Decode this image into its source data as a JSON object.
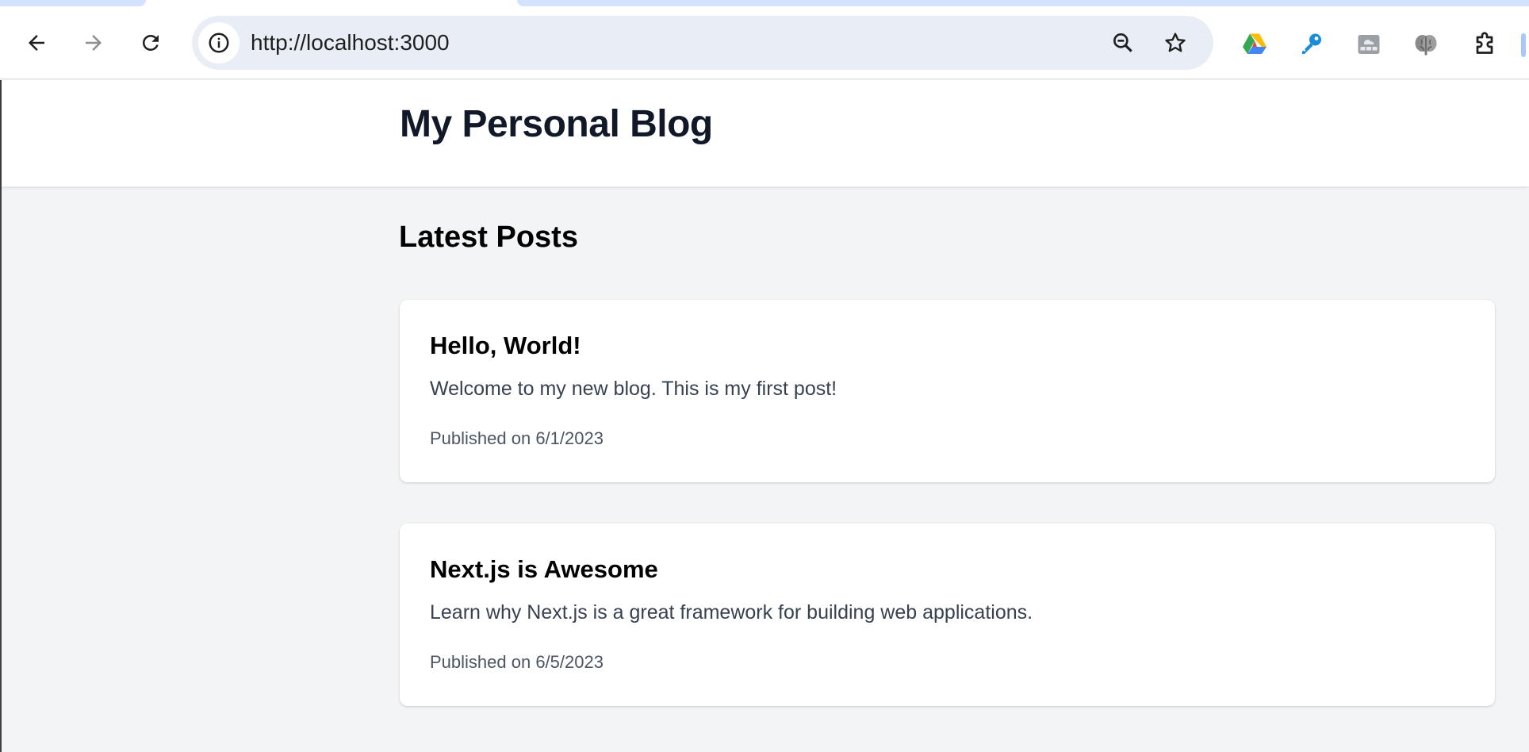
{
  "browser": {
    "url": "http://localhost:3000",
    "icons": {
      "back": "arrow-left-icon",
      "forward": "arrow-right-icon",
      "reload": "reload-icon",
      "site_info": "info-icon",
      "zoom": "zoom-out-icon",
      "bookmark": "star-icon",
      "extensions": [
        "google-drive-icon",
        "blue-key-icon",
        "cloud-grid-icon",
        "brain-icon",
        "puzzle-piece-icon"
      ]
    }
  },
  "header": {
    "title": "My Personal Blog"
  },
  "main": {
    "section_title": "Latest Posts",
    "posts": [
      {
        "title": "Hello, World!",
        "excerpt": "Welcome to my new blog. This is my first post!",
        "date": "Published on 6/1/2023"
      },
      {
        "title": "Next.js is Awesome",
        "excerpt": "Learn why Next.js is a great framework for building web applications.",
        "date": "Published on 6/5/2023"
      }
    ]
  },
  "colors": {
    "page_background": "#f3f4f6",
    "card_background": "#ffffff",
    "title_text": "#111827",
    "excerpt_text": "#374151",
    "date_text": "#4b5563"
  }
}
